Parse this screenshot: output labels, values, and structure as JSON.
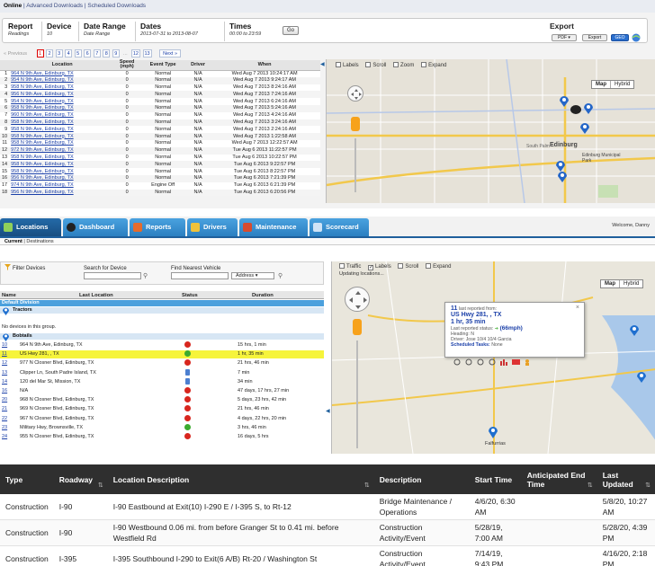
{
  "panel1": {
    "nav": {
      "online": "Online",
      "advanced": "Advanced Downloads",
      "scheduled": "Scheduled Downloads"
    },
    "filters": [
      {
        "title": "Report",
        "sub": "Readings"
      },
      {
        "title": "Device",
        "sub": "10"
      },
      {
        "title": "Date Range",
        "sub": "Date Range"
      },
      {
        "title": "Dates",
        "sub": "2013-07-31 to 2013-08-07"
      },
      {
        "title": "Times",
        "sub": "00:00 to 23:59"
      }
    ],
    "go_label": "Go",
    "export": {
      "title": "Export",
      "pdf": "PDF",
      "export_btn": "Export",
      "geo": "GEO"
    },
    "pager": {
      "prev": "« Previous",
      "pages": [
        "1",
        "2",
        "3",
        "4",
        "5",
        "6",
        "7",
        "8",
        "9",
        "...",
        "12",
        "13"
      ],
      "next": "Next »"
    },
    "columns": [
      "",
      "Location",
      "Speed (mph)",
      "Event Type",
      "Driver",
      "When"
    ],
    "rows": [
      [
        "1",
        "964 N 9th Ave, Edinburg, TX",
        "0",
        "Normal",
        "N/A",
        "Wed Aug 7 2013 10:24:17 AM"
      ],
      [
        "2",
        "954 N 9th Ave, Edinburg, TX",
        "0",
        "Normal",
        "N/A",
        "Wed Aug 7 2013 9:24:17 AM"
      ],
      [
        "3",
        "958 N 9th Ave, Edinburg, TX",
        "0",
        "Normal",
        "N/A",
        "Wed Aug 7 2013 8:24:16 AM"
      ],
      [
        "4",
        "956 N 9th Ave, Edinburg, TX",
        "0",
        "Normal",
        "N/A",
        "Wed Aug 7 2013 7:24:16 AM"
      ],
      [
        "5",
        "954 N 9th Ave, Edinburg, TX",
        "0",
        "Normal",
        "N/A",
        "Wed Aug 7 2013 6:24:16 AM"
      ],
      [
        "6",
        "958 N 9th Ave, Edinburg, TX",
        "0",
        "Normal",
        "N/A",
        "Wed Aug 7 2013 5:24:16 AM"
      ],
      [
        "7",
        "960 N 9th Ave, Edinburg, TX",
        "0",
        "Normal",
        "N/A",
        "Wed Aug 7 2013 4:24:16 AM"
      ],
      [
        "8",
        "958 N 9th Ave, Edinburg, TX",
        "0",
        "Normal",
        "N/A",
        "Wed Aug 7 2013 3:24:16 AM"
      ],
      [
        "9",
        "958 N 9th Ave, Edinburg, TX",
        "0",
        "Normal",
        "N/A",
        "Wed Aug 7 2013 2:24:16 AM"
      ],
      [
        "10",
        "958 N 9th Ave, Edinburg, TX",
        "0",
        "Normal",
        "N/A",
        "Wed Aug 7 2013 1:22:58 AM"
      ],
      [
        "11",
        "958 N 9th Ave, Edinburg, TX",
        "0",
        "Normal",
        "N/A",
        "Wed Aug 7 2013 12:22:57 AM"
      ],
      [
        "12",
        "972 N 9th Ave, Edinburg, TX",
        "0",
        "Normal",
        "N/A",
        "Tue Aug 6 2013 11:22:57 PM"
      ],
      [
        "13",
        "958 N 9th Ave, Edinburg, TX",
        "0",
        "Normal",
        "N/A",
        "Tue Aug 6 2013 10:22:57 PM"
      ],
      [
        "14",
        "958 N 9th Ave, Edinburg, TX",
        "0",
        "Normal",
        "N/A",
        "Tue Aug 6 2013 9:22:57 PM"
      ],
      [
        "15",
        "958 N 9th Ave, Edinburg, TX",
        "0",
        "Normal",
        "N/A",
        "Tue Aug 6 2013 8:22:57 PM"
      ],
      [
        "16",
        "956 N 9th Ave, Edinburg, TX",
        "0",
        "Normal",
        "N/A",
        "Tue Aug 6 2013 7:21:39 PM"
      ],
      [
        "17",
        "974 N 9th Ave, Edinburg, TX",
        "0",
        "Engine Off",
        "N/A",
        "Tue Aug 6 2013 6:21:39 PM"
      ],
      [
        "18",
        "956 N 9th Ave, Edinburg, TX",
        "0",
        "Normal",
        "N/A",
        "Tue Aug 6 2013 6:20:56 PM"
      ]
    ],
    "map_options": [
      "Labels",
      "Scroll",
      "Zoom",
      "Expand"
    ],
    "map_toggle": {
      "map": "Map",
      "hybrid": "Hybrid"
    },
    "map_labels": {
      "city": "Edinburg",
      "city2": "South Palm",
      "muni": "Edinburg Municipal Park"
    }
  },
  "panel2": {
    "tabs": [
      "Locations",
      "Dashboard",
      "Reports",
      "Drivers",
      "Maintenance",
      "Scorecard"
    ],
    "welcome": "Welcome, Danny",
    "sub": {
      "current": "Current",
      "destinations": "Destinations"
    },
    "search": {
      "filter": "Filter Devices",
      "search_device": "Search for Device",
      "nearest": "Find Nearest Vehicle",
      "address": "Address"
    },
    "columns": {
      "name": "Name",
      "last_location": "Last Location",
      "status": "Status",
      "duration": "Duration"
    },
    "division": "Default Division",
    "group1": "Tractors",
    "empty": "No devices in this group.",
    "group2": "Bobtails",
    "rows": [
      {
        "id": "10",
        "loc": "964 N 9th Ave, Edinburg, TX",
        "status": "red",
        "dur": "15 hrs, 1 min"
      },
      {
        "id": "11",
        "loc": "US Hwy 281, , TX",
        "status": "green",
        "dur": "1 hr, 35 min"
      },
      {
        "id": "12",
        "loc": "977 N Closner Blvd, Edinburg, TX",
        "status": "red",
        "dur": "21 hrs, 46 min"
      },
      {
        "id": "13",
        "loc": "Clipper Ln, South Padre Island, TX",
        "status": "blue",
        "dur": "7 min"
      },
      {
        "id": "14",
        "loc": "120 del Mar St, Mission, TX",
        "status": "blue",
        "dur": "34 min"
      },
      {
        "id": "16",
        "loc": "N/A",
        "status": "red",
        "dur": "47 days, 17 hrs, 27 min"
      },
      {
        "id": "20",
        "loc": "968 N Closner Blvd, Edinburg, TX",
        "status": "red",
        "dur": "5 days, 23 hrs, 42 min"
      },
      {
        "id": "21",
        "loc": "969 N Closner Blvd, Edinburg, TX",
        "status": "red",
        "dur": "21 hrs, 46 min"
      },
      {
        "id": "22",
        "loc": "967 N Closner Blvd, Edinburg, TX",
        "status": "red",
        "dur": "4 days, 22 hrs, 20 min"
      },
      {
        "id": "23",
        "loc": "Military Hwy, Brownsville, TX",
        "status": "green",
        "dur": "3 hrs, 46 min"
      },
      {
        "id": "24",
        "loc": "955 N Closner Blvd, Edinburg, TX",
        "status": "red",
        "dur": "16 days, 5 hrs"
      }
    ],
    "map_options": [
      "Traffic",
      "Labels",
      "Scroll",
      "Expand"
    ],
    "updating": "Updating locations...",
    "map_toggle": {
      "map": "Map",
      "hybrid": "Hybrid"
    },
    "popup": {
      "num": "11",
      "reported": "last reported from:",
      "addr": "US Hwy 281, , TX",
      "time": "1 hr, 35 min",
      "last_status": "Last reported status:",
      "speed": "(66mph)",
      "heading": "Heading: N",
      "driver": "Driver: Jose 10/4 10/4 Garcia",
      "tasks": "Scheduled Tasks:",
      "tasks_val": "None"
    },
    "map_labels": {
      "town": "Falfurrias"
    },
    "colors": {
      "red": "#d8261e",
      "green": "#3cab2f",
      "blue": "#4c7fd0",
      "highlight": "#f6f43b",
      "tab": "#3a8fd2"
    }
  },
  "panel3": {
    "columns": [
      "Type",
      "Roadway",
      "Location Description",
      "Description",
      "Start Time",
      "Anticipated End Time",
      "Last Updated"
    ],
    "rows": [
      [
        "Construction",
        "I-90",
        "I-90 Eastbound at Exit(10) I-290 E / I-395 S, to Rt-12",
        "Bridge Maintenance / Operations",
        "4/6/20, 6:30 AM",
        "",
        "5/8/20, 10:27 AM"
      ],
      [
        "Construction",
        "I-90",
        "I-90 Westbound 0.06 mi. from before Granger St to 0.41 mi. before Westfield Rd",
        "Construction Activity/Event",
        "5/28/19, 7:00 AM",
        "",
        "5/28/20, 4:39 PM"
      ],
      [
        "Construction",
        "I-395",
        "I-395 Southbound I-290 to Exit(6 A/B) Rt-20 / Washington St",
        "Construction Activity/Event",
        "7/14/19, 9:43 PM",
        "",
        "4/16/20, 2:18 PM"
      ]
    ]
  }
}
